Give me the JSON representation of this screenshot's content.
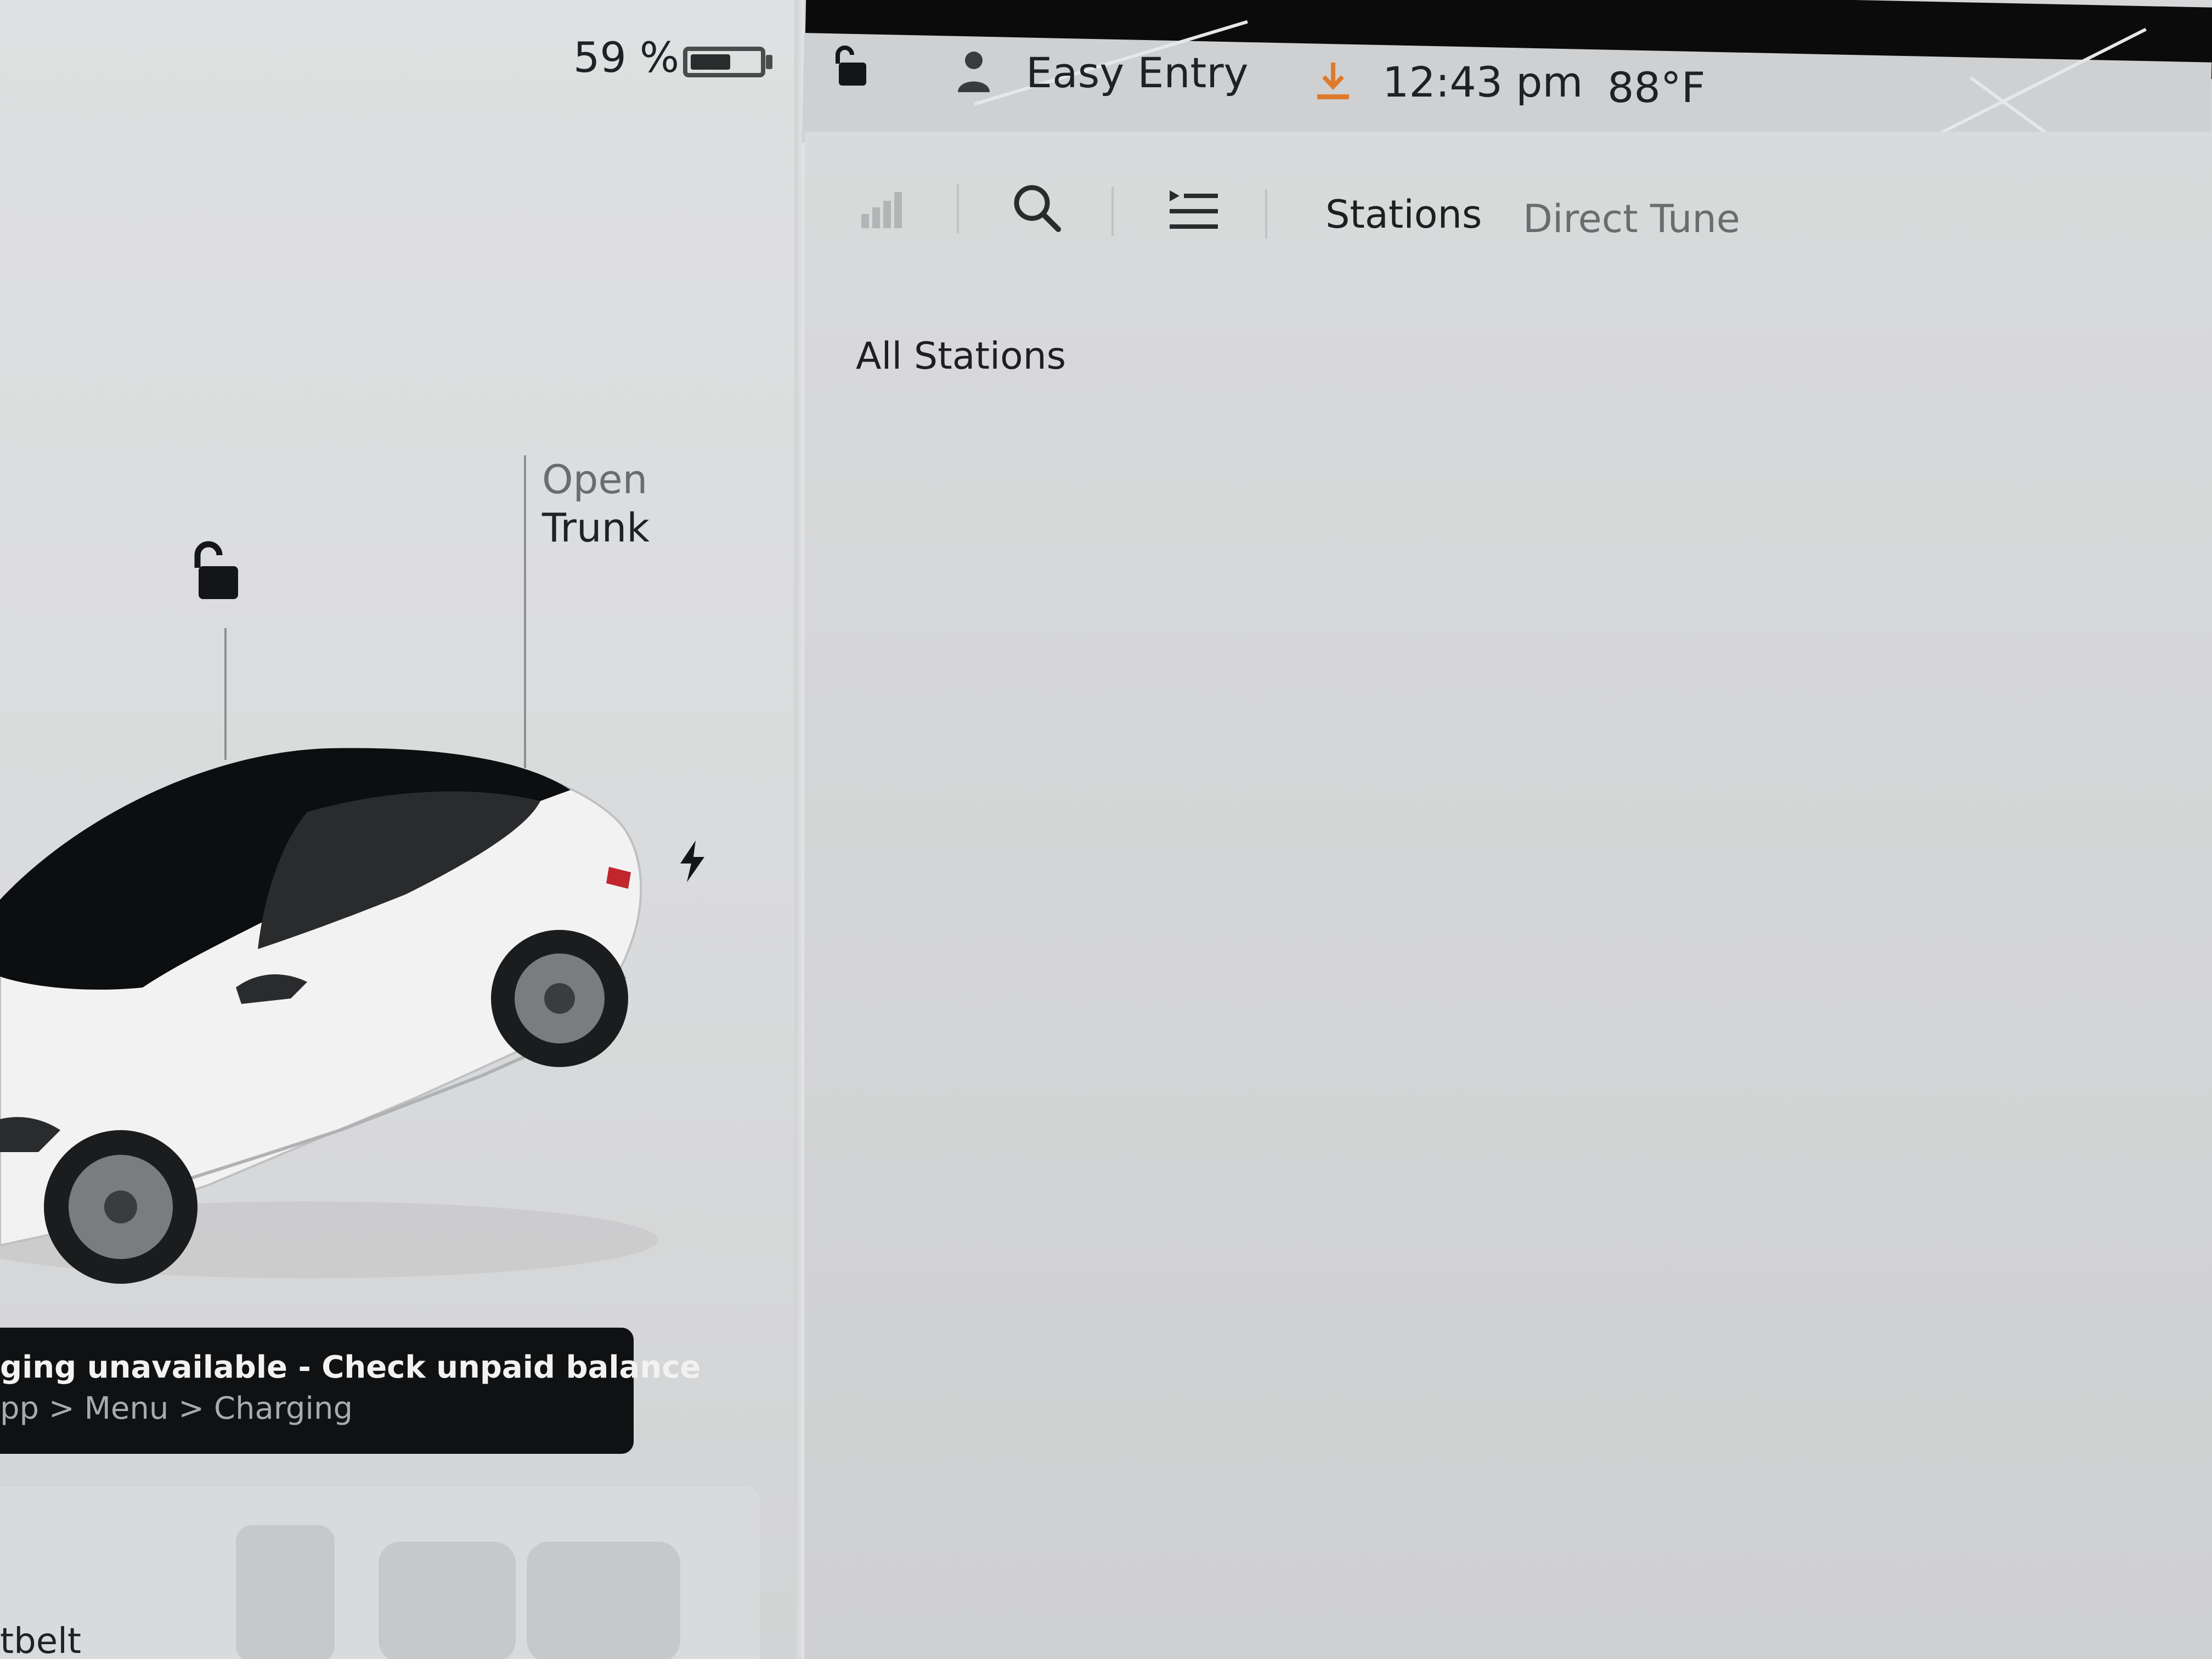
{
  "status_bar": {
    "battery_percent": "59 %",
    "battery_level": 0.59,
    "profile_name": "Easy Entry",
    "time": "12:43 pm",
    "temperature": "88°F"
  },
  "car": {
    "open_trunk_line1": "Open",
    "open_trunk_line2": "Trunk"
  },
  "media": {
    "tabs": [
      "Stations",
      "Direct Tune"
    ],
    "section_title": "All Stations"
  },
  "toast": {
    "title": "ging unavailable - Check unpaid balance",
    "subtitle": "pp > Menu > Charging"
  },
  "seats": {
    "label": "tbelt"
  },
  "colors": {
    "download_accent": "#e07a2b",
    "toast_background": "#101113"
  }
}
